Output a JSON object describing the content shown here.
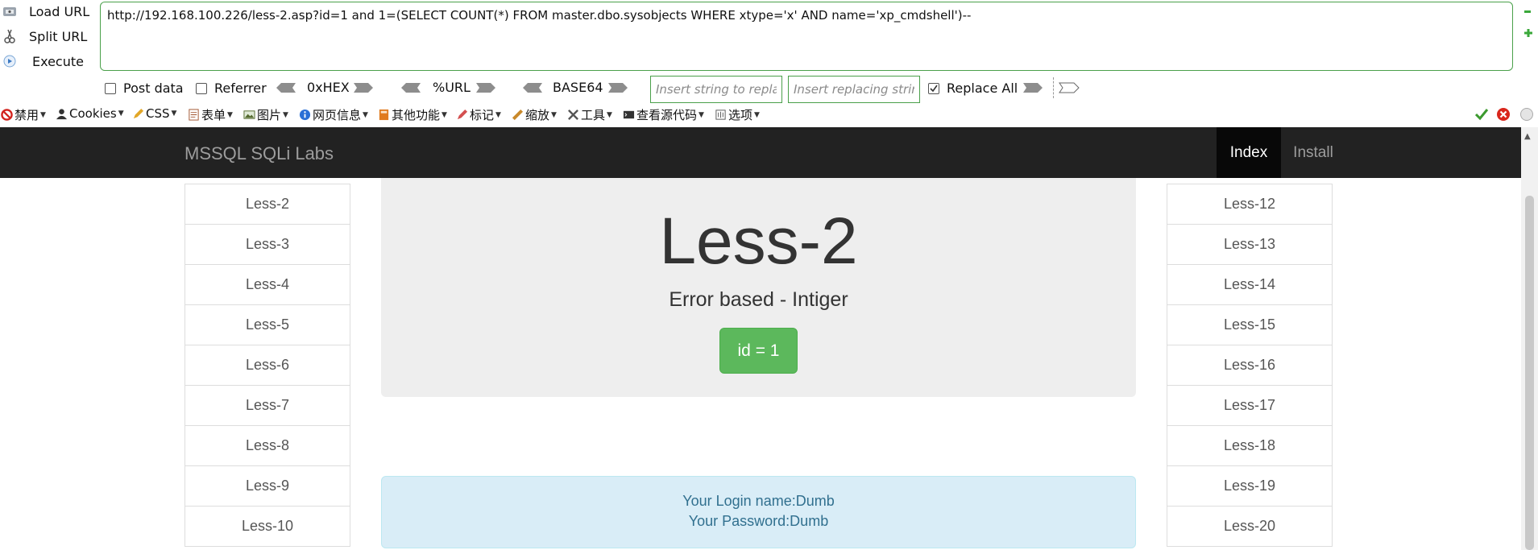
{
  "hackbar": {
    "load_url": "Load URL",
    "split_url": "Split URL",
    "execute": "Execute",
    "url_value": "http://192.168.100.226/less-2.asp?id=1 and 1=(SELECT COUNT(*) FROM master.dbo.sysobjects WHERE xtype='x' AND name='xp_cmdshell')--",
    "post_data": "Post data",
    "referrer": "Referrer",
    "hex": "0xHEX",
    "url_enc": "%URL",
    "base64": "BASE64",
    "replace_placeholder": "Insert string to replace",
    "replacing_placeholder": "Insert replacing string",
    "replace_all": "Replace All",
    "replace_all_checked": true,
    "accent_color": "#4aa04a"
  },
  "toolbar": {
    "items": [
      "禁用",
      "Cookies",
      "CSS",
      "表单",
      "图片",
      "网页信息",
      "其他功能",
      "标记",
      "缩放",
      "工具",
      "查看源代码",
      "选项"
    ]
  },
  "navbar": {
    "brand": "MSSQL SQLi Labs",
    "index": "Index",
    "install": "Install"
  },
  "left_lessons": [
    "Less-2",
    "Less-3",
    "Less-4",
    "Less-5",
    "Less-6",
    "Less-7",
    "Less-8",
    "Less-9",
    "Less-10"
  ],
  "right_lessons": [
    "Less-12",
    "Less-13",
    "Less-14",
    "Less-15",
    "Less-16",
    "Less-17",
    "Less-18",
    "Less-19",
    "Less-20"
  ],
  "main": {
    "title": "Less-2",
    "subtitle": "Error based - Intiger",
    "id_button": "id = 1",
    "login_line": "Your Login name:Dumb",
    "password_line": "Your Password:Dumb"
  }
}
